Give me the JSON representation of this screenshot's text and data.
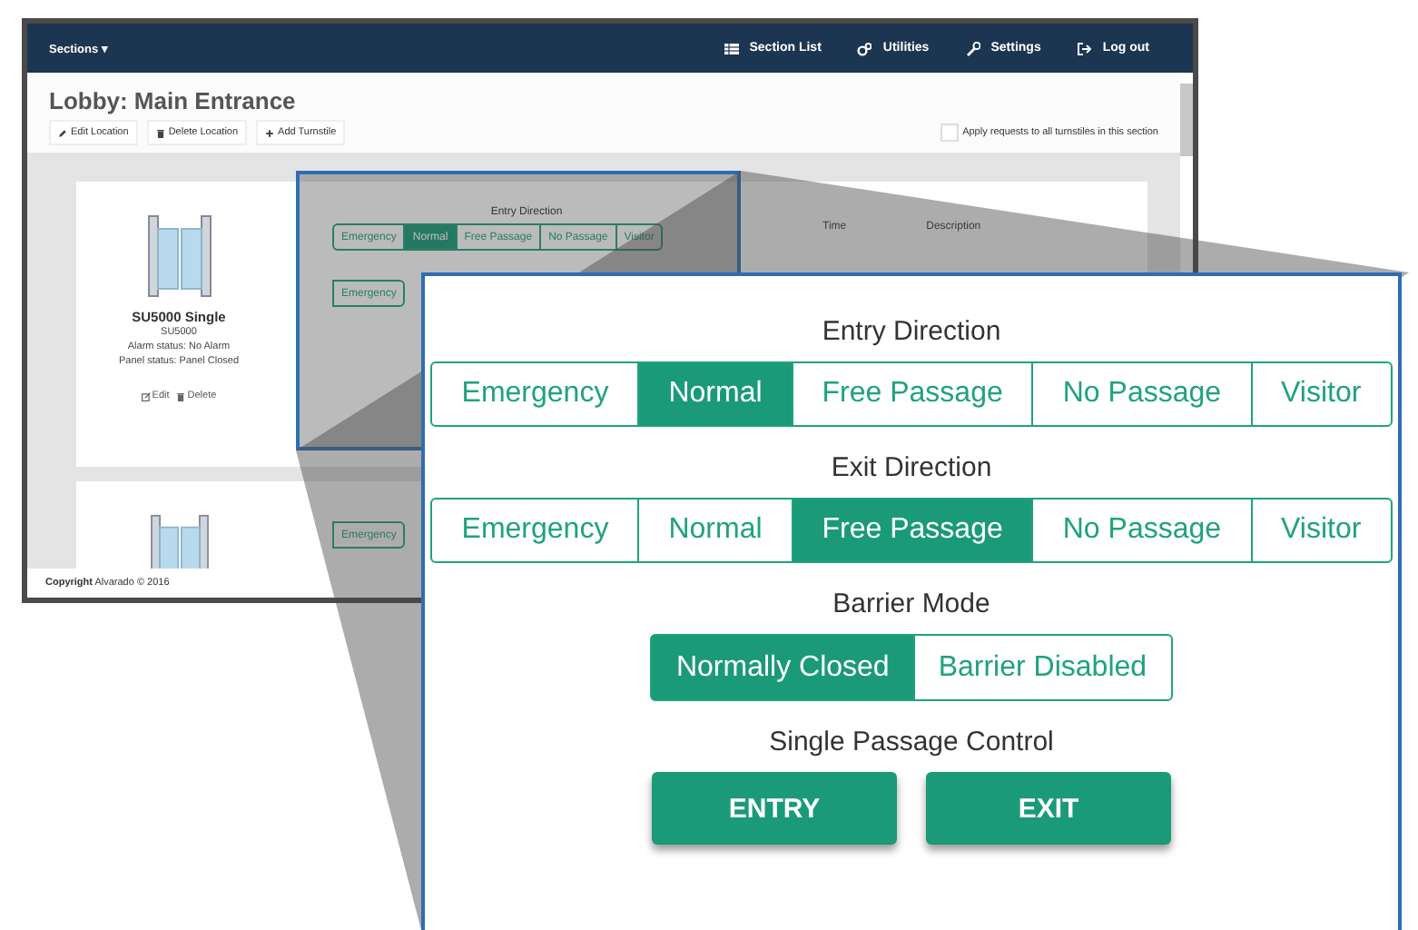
{
  "navbar": {
    "menu": "Sections ▾",
    "items": [
      {
        "label": "Section List"
      },
      {
        "label": "Utilities"
      },
      {
        "label": "Settings"
      },
      {
        "label": "Log out"
      }
    ]
  },
  "page": {
    "title": "Lobby: Main Entrance",
    "actions": [
      "Edit Location",
      "Delete Location",
      "Add Turnstile"
    ],
    "apply_all": {
      "label": "Apply requests to all turnstiles in this section",
      "checked": false
    }
  },
  "turnstile_card": {
    "name": "SU5000 Single",
    "model": "SU5000",
    "alarm_status": "Alarm status:  No Alarm",
    "panel_status": "Panel status:  Panel Closed",
    "links": [
      "Edit",
      "Delete"
    ],
    "controls": {
      "label": "Entry Direction",
      "entry": [
        {
          "label": "Emergency",
          "selected": false
        },
        {
          "label": "Normal",
          "selected": true
        },
        {
          "label": "Free Passage",
          "selected": false
        },
        {
          "label": "No Passage",
          "selected": false
        },
        {
          "label": "Visitor",
          "selected": false
        }
      ],
      "exit": [
        {
          "label": "Emergency",
          "selected": false
        }
      ]
    },
    "events_table": {
      "columns": [
        "Time",
        "Description"
      ]
    }
  },
  "second_card": {
    "entry": [
      {
        "label": "Emergency",
        "selected": false
      }
    ]
  },
  "footer": {
    "copyright": "**Copyright** Alvarado © 2016"
  },
  "callout": {
    "entry_label": "Entry Direction",
    "entry": [
      {
        "label": "Emergency",
        "selected": false
      },
      {
        "label": "Normal",
        "selected": true
      },
      {
        "label": "Free Passage",
        "selected": false
      },
      {
        "label": "No Passage",
        "selected": false
      },
      {
        "label": "Visitor",
        "selected": false
      }
    ],
    "exit_label": "Exit Direction",
    "exit": [
      {
        "label": "Emergency",
        "selected": false
      },
      {
        "label": "Normal",
        "selected": false
      },
      {
        "label": "Free Passage",
        "selected": true
      },
      {
        "label": "No Passage",
        "selected": false
      },
      {
        "label": "Visitor",
        "selected": false
      }
    ],
    "barrier_label": "Barrier Mode",
    "barrier": [
      {
        "label": "Normally Closed",
        "selected": true
      },
      {
        "label": "Barrier Disabled",
        "selected": false
      }
    ],
    "passage_label": "Single Passage Control",
    "buttons": [
      "ENTRY",
      "EXIT"
    ]
  }
}
